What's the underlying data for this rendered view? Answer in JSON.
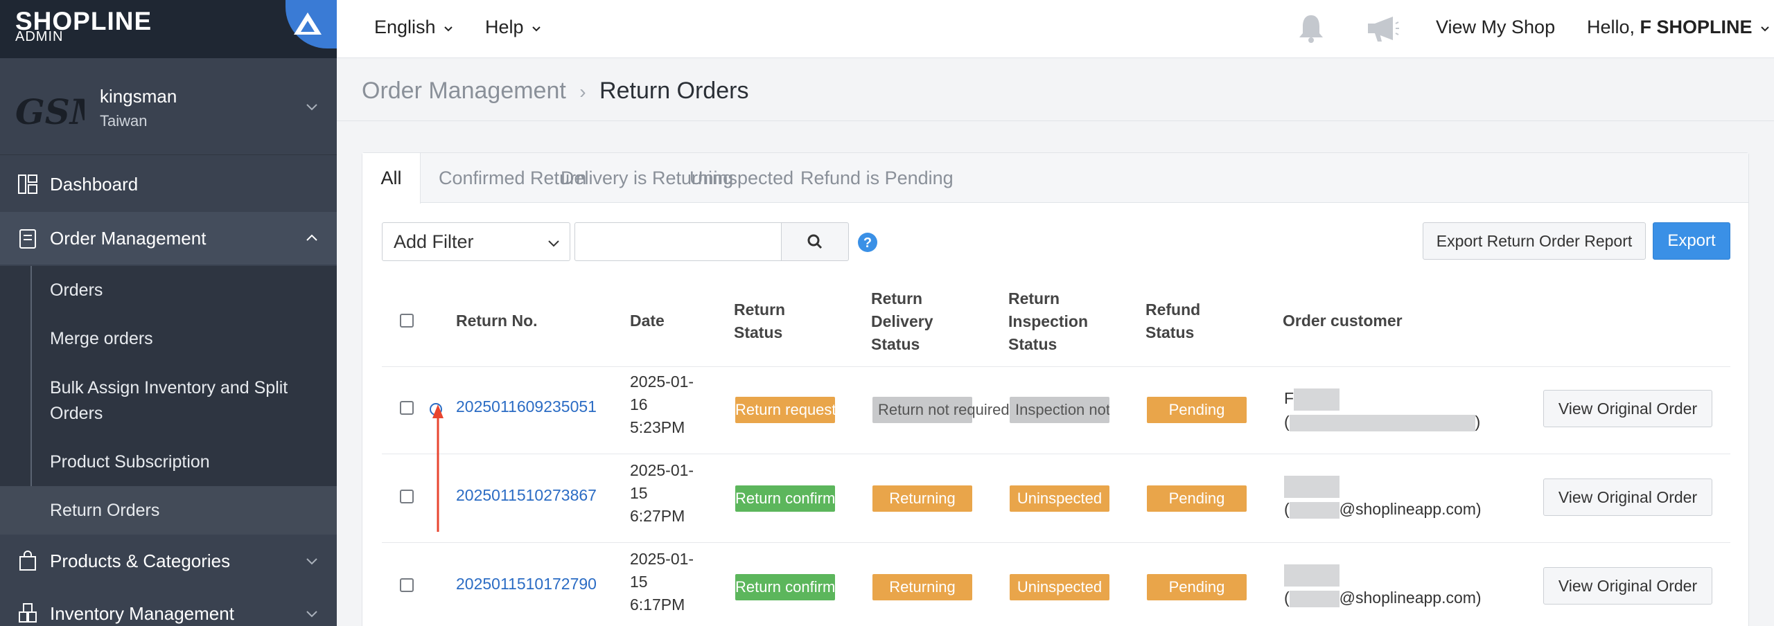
{
  "logo": {
    "brand": "SHOPLINE",
    "sub": "ADMIN"
  },
  "store": {
    "logo_text": "GSM",
    "name": "kingsman",
    "region": "Taiwan"
  },
  "nav": {
    "dashboard": "Dashboard",
    "order_management": "Order Management",
    "sub_items": [
      "Orders",
      "Merge orders",
      "Bulk Assign Inventory and Split",
      "Orders",
      "Product Subscription",
      "Return Orders"
    ],
    "products": "Products & Categories",
    "inventory": "Inventory Management"
  },
  "topbar": {
    "language": "English",
    "help": "Help",
    "view_shop": "View My Shop",
    "hello": "Hello,",
    "user": "F SHOPLINE"
  },
  "breadcrumb": {
    "parent": "Order Management",
    "current": "Return Orders"
  },
  "tabs": [
    "All",
    "Confirmed Return",
    "Delivery is Returning",
    "Uninspected",
    "Refund is Pending"
  ],
  "filter": {
    "label": "Add Filter",
    "search_value": ""
  },
  "buttons": {
    "export_report": "Export Return Order Report",
    "export": "Export",
    "view_original": "View Original Order"
  },
  "table": {
    "headers": {
      "return_no": "Return No.",
      "date": "Date",
      "return_status": [
        "Return",
        "Status"
      ],
      "return_delivery_status": [
        "Return",
        "Delivery",
        "Status"
      ],
      "return_inspection_status": [
        "Return",
        "Inspection",
        "Status"
      ],
      "refund_status": [
        "Refund",
        "Status"
      ],
      "order_customer": "Order customer"
    },
    "rows": [
      {
        "return_no": "2025011609235051",
        "date": [
          "2025-01-",
          "16",
          "5:23PM"
        ],
        "return_status": "Return requested",
        "delivery_status": "Return not required",
        "inspection_status": "Inspection not required",
        "refund_status": "Pending",
        "customer_name": "F",
        "customer_email": ""
      },
      {
        "return_no": "2025011510273867",
        "date": [
          "2025-01-",
          "15",
          "6:27PM"
        ],
        "return_status": "Return confirmed",
        "delivery_status": "Returning",
        "inspection_status": "Uninspected",
        "refund_status": "Pending",
        "customer_name": "",
        "customer_email": "@shoplineapp.com)"
      },
      {
        "return_no": "2025011510172790",
        "date": [
          "2025-01-",
          "15",
          "6:17PM"
        ],
        "return_status": "Return confirmed",
        "delivery_status": "Returning",
        "inspection_status": "Uninspected",
        "refund_status": "Pending",
        "customer_name": "",
        "customer_email": "@shoplineapp.com)"
      }
    ]
  },
  "colors": {
    "sidebar": "#3a4250",
    "accent": "#3a90e6",
    "link": "#2b6cc4",
    "pending": "#e9a54a",
    "confirmed": "#5cb65c",
    "annotation": "#e8452f"
  }
}
